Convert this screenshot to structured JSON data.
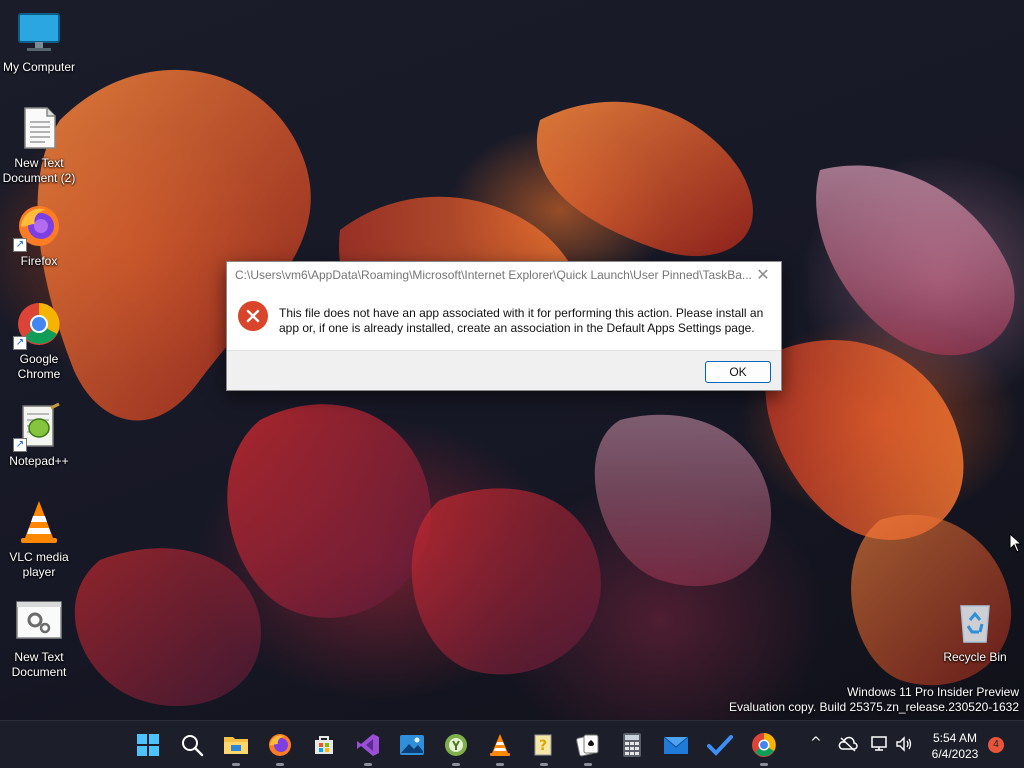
{
  "desktop": {
    "icons": [
      {
        "label": "My Computer",
        "icon": "monitor-icon"
      },
      {
        "label": "New Text Document (2)",
        "icon": "text-document-icon"
      },
      {
        "label": "Firefox",
        "icon": "firefox-icon"
      },
      {
        "label": "Google Chrome",
        "icon": "chrome-icon"
      },
      {
        "label": "Notepad++",
        "icon": "notepadpp-icon"
      },
      {
        "label": "VLC media player",
        "icon": "vlc-icon"
      },
      {
        "label": "New Text Document",
        "icon": "settings-document-icon"
      },
      {
        "label": "Recycle Bin",
        "icon": "recycle-bin-icon"
      }
    ],
    "watermark_line1": "Windows 11 Pro Insider Preview",
    "watermark_line2": "Evaluation copy. Build 25375.zn_release.230520-1632"
  },
  "dialog": {
    "title": "C:\\Users\\vm6\\AppData\\Roaming\\Microsoft\\Internet Explorer\\Quick Launch\\User Pinned\\TaskBa...",
    "message": "This file does not have an app associated with it for performing this action. Please install an app or, if one is already installed, create an association in the Default Apps Settings page.",
    "ok_label": "OK",
    "close_glyph": "✕",
    "icon": "error-icon"
  },
  "taskbar": {
    "apps": [
      {
        "name": "start-button",
        "icon": "windows-logo-icon"
      },
      {
        "name": "search-button",
        "icon": "search-icon"
      },
      {
        "name": "file-explorer",
        "icon": "folder-icon"
      },
      {
        "name": "firefox",
        "icon": "firefox-icon"
      },
      {
        "name": "microsoft-store",
        "icon": "store-icon"
      },
      {
        "name": "visual-studio",
        "icon": "visual-studio-icon"
      },
      {
        "name": "photos",
        "icon": "photos-icon"
      },
      {
        "name": "app-green",
        "icon": "green-circle-icon"
      },
      {
        "name": "vlc",
        "icon": "vlc-icon"
      },
      {
        "name": "help-app",
        "icon": "help-icon"
      },
      {
        "name": "solitaire",
        "icon": "cards-icon"
      },
      {
        "name": "calculator",
        "icon": "calculator-icon"
      },
      {
        "name": "mail",
        "icon": "mail-icon"
      },
      {
        "name": "todo",
        "icon": "checkmark-icon"
      },
      {
        "name": "chrome",
        "icon": "chrome-icon"
      }
    ],
    "tray": {
      "chevron": "^",
      "time": "5:54 AM",
      "date": "6/4/2023",
      "notification_count": "4"
    }
  },
  "colors": {
    "accent": "#0067c0",
    "error": "#d9452a",
    "taskbar": "#1c1f2a"
  }
}
